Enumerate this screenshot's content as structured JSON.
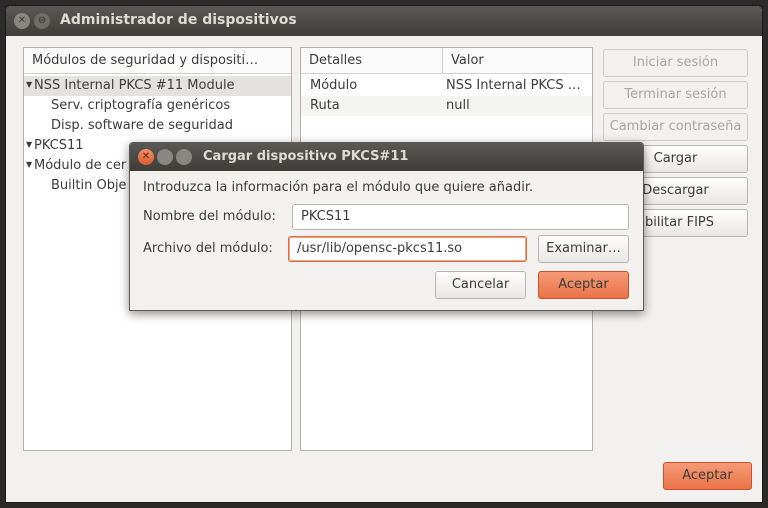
{
  "window": {
    "title": "Administrador de dispositivos",
    "close_glyph": "✕",
    "min_glyph": "⊖"
  },
  "tree": {
    "header": "Módulos de seguridad y dispositi…",
    "items": [
      {
        "label": "NSS Internal PKCS #11 Module",
        "expanded_glyph": "▼"
      },
      {
        "label": "Serv. criptografía genéricos"
      },
      {
        "label": "Disp. software de seguridad"
      },
      {
        "label": "PKCS11",
        "expanded_glyph": "▼"
      },
      {
        "label": "Módulo de cer",
        "expanded_glyph": "▼"
      },
      {
        "label": "Builtin Obje"
      }
    ]
  },
  "details": {
    "headers": [
      "Detalles",
      "Valor"
    ],
    "rows": [
      {
        "detail": "Módulo",
        "value": "NSS Internal PKCS …"
      },
      {
        "detail": "Ruta",
        "value": "null"
      }
    ]
  },
  "side_buttons": {
    "login": "Iniciar sesión",
    "logout": "Terminar sesión",
    "change_password": "Cambiar contraseña",
    "load": "Cargar",
    "unload": "Descargar",
    "fips": "abilitar FIPS"
  },
  "main_accept": "Aceptar",
  "dialog": {
    "title": "Cargar dispositivo PKCS#11",
    "intro": "Introduzca la información para el módulo que quiere añadir.",
    "name_label": "Nombre del módulo:",
    "name_value": "PKCS11",
    "file_label": "Archivo del módulo:",
    "file_value": "/usr/lib/opensc-pkcs11.so",
    "browse": "Examinar…",
    "cancel": "Cancelar",
    "accept": "Aceptar",
    "close_glyph": "✕"
  },
  "colors": {
    "accent": "#ea7348",
    "titlebar": "#3e3d39",
    "window_bg": "#f2f1f0"
  }
}
